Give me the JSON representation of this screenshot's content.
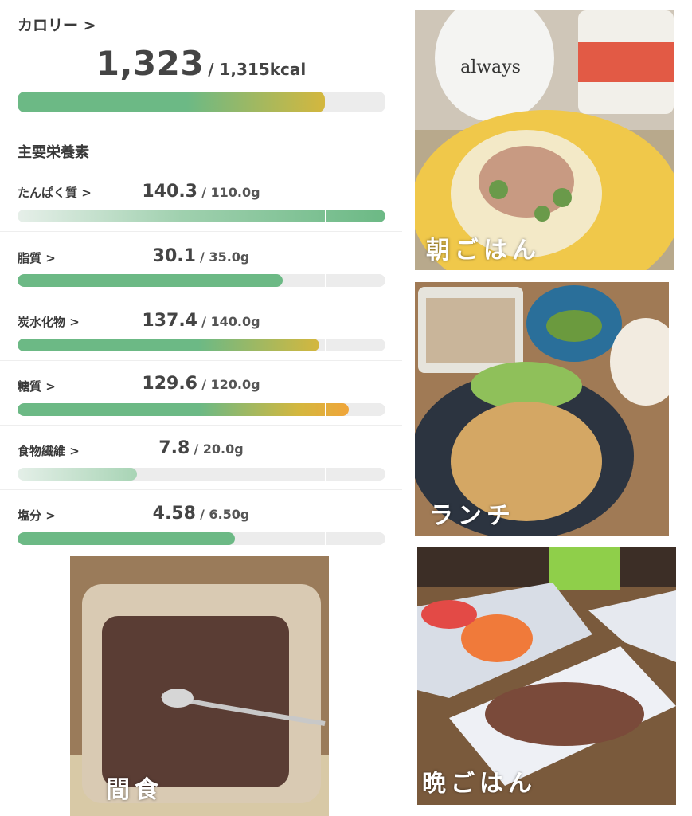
{
  "calorie": {
    "title": "カロリー >",
    "value": "1,323",
    "goal": "/ 1,315kcal",
    "progress": 0.835
  },
  "nutrients_title": "主要栄養素",
  "nutrients": [
    {
      "label": "たんぱく質 >",
      "value": "140.3",
      "goal": "/ 110.0g",
      "progress": 1.0,
      "fill": "protein"
    },
    {
      "label": "脂質 >",
      "value": "30.1",
      "goal": "/ 35.0g",
      "progress": 0.72,
      "fill": "green"
    },
    {
      "label": "炭水化物 >",
      "value": "137.4",
      "goal": "/ 140.0g",
      "progress": 0.82,
      "fill": "yellow"
    },
    {
      "label": "糖質 >",
      "value": "129.6",
      "goal": "/ 120.0g",
      "progress": 0.9,
      "fill": "orange"
    },
    {
      "label": "食物繊維 >",
      "value": "7.8",
      "goal": "/ 20.0g",
      "progress": 0.325,
      "fill": "light"
    },
    {
      "label": "塩分 >",
      "value": "4.58",
      "goal": "/ 6.50g",
      "progress": 0.59,
      "fill": "green"
    }
  ],
  "photos": {
    "breakfast": "朝ごはん",
    "lunch": "ランチ",
    "snack": "間食",
    "dinner": "晩ごはん"
  },
  "colors": {
    "green": "#6cb985",
    "yellow": "#d4b73e",
    "orange": "#f0a53a",
    "track": "#ececec"
  }
}
